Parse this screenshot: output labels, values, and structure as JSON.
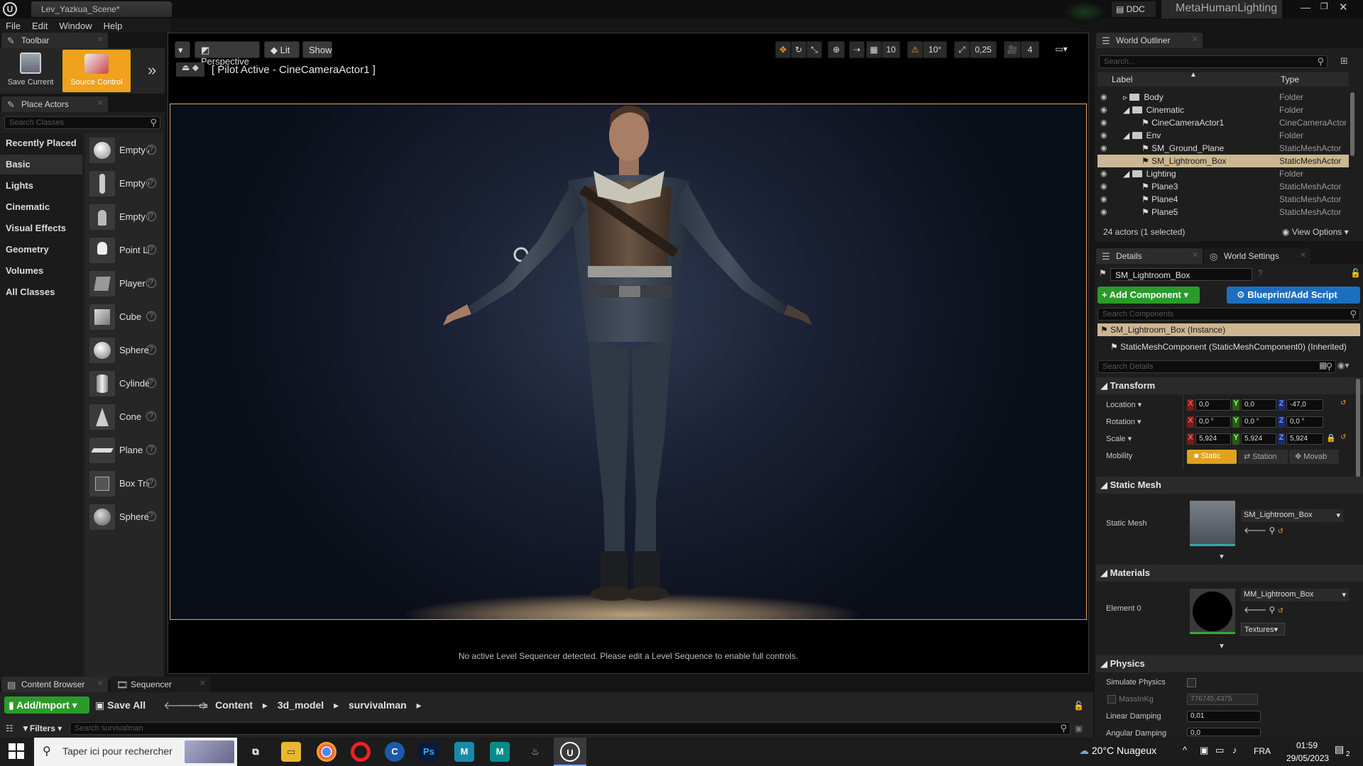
{
  "window": {
    "tab_title": "Lev_Yazkua_Scene*",
    "project_name": "MetaHumanLighting",
    "ddc_label": "DDC"
  },
  "menu": [
    "File",
    "Edit",
    "Window",
    "Help"
  ],
  "toolbar": {
    "tab": "Toolbar",
    "save_current": "Save Current",
    "source_control": "Source Control"
  },
  "place_actors": {
    "tab": "Place Actors",
    "search_placeholder": "Search Classes",
    "categories": [
      "Recently Placed",
      "Basic",
      "Lights",
      "Cinematic",
      "Visual Effects",
      "Geometry",
      "Volumes",
      "All Classes"
    ],
    "selected_category": "Basic",
    "items": [
      "Empty Actor",
      "Empty Character",
      "Empty Pawn",
      "Point Light",
      "Player Start",
      "Cube",
      "Sphere",
      "Cylinder",
      "Cone",
      "Plane",
      "Box Trigger",
      "Sphere Trigger"
    ]
  },
  "viewport": {
    "perspective": "Perspective",
    "lit": "Lit",
    "show": "Show",
    "pilot": "[ Pilot Active - CineCameraActor1 ]",
    "grid_snap": "10",
    "rot_snap": "10°",
    "scale_snap": "0,25",
    "cam_speed": "4",
    "sequencer_msg": "No active Level Sequencer detected. Please edit a Level Sequence to enable full controls."
  },
  "outliner": {
    "tab": "World Outliner",
    "search_placeholder": "Search...",
    "col_label": "Label",
    "col_type": "Type",
    "rows": [
      {
        "label": "Body",
        "type": "Folder",
        "indent": 1,
        "folder": true
      },
      {
        "label": "Cinematic",
        "type": "Folder",
        "indent": 1,
        "folder": true
      },
      {
        "label": "CineCameraActor1",
        "type": "CineCameraActor",
        "indent": 2
      },
      {
        "label": "Env",
        "type": "Folder",
        "indent": 1,
        "folder": true
      },
      {
        "label": "SM_Ground_Plane",
        "type": "StaticMeshActor",
        "indent": 2
      },
      {
        "label": "SM_Lightroom_Box",
        "type": "StaticMeshActor",
        "indent": 2,
        "selected": true
      },
      {
        "label": "Lighting",
        "type": "Folder",
        "indent": 1,
        "folder": true
      },
      {
        "label": "Plane3",
        "type": "StaticMeshActor",
        "indent": 2
      },
      {
        "label": "Plane4",
        "type": "StaticMeshActor",
        "indent": 2
      },
      {
        "label": "Plane5",
        "type": "StaticMeshActor",
        "indent": 2
      }
    ],
    "count": "24 actors (1 selected)",
    "view_options": "View Options"
  },
  "details": {
    "tab": "Details",
    "tab2": "World Settings",
    "name": "SM_Lightroom_Box",
    "add_component": "+ Add Component",
    "blueprint": "Blueprint/Add Script",
    "search_components": "Search Components",
    "instance": "SM_Lightroom_Box (Instance)",
    "component": "StaticMeshComponent (StaticMeshComponent0) (Inherited)",
    "search_details": "Search Details",
    "transform": {
      "title": "Transform",
      "location_label": "Location",
      "rotation_label": "Rotation",
      "scale_label": "Scale",
      "mobility_label": "Mobility",
      "location": [
        "0,0",
        "0,0",
        "-47,0"
      ],
      "rotation": [
        "0,0 °",
        "0,0 °",
        "0,0 °"
      ],
      "scale": [
        "5,924",
        "5,924",
        "5,924"
      ],
      "mobility": [
        "Static",
        "Station",
        "Movab"
      ]
    },
    "static_mesh": {
      "title": "Static Mesh",
      "label": "Static Mesh",
      "value": "SM_Lightroom_Box"
    },
    "materials": {
      "title": "Materials",
      "label": "Element 0",
      "value": "MM_Lightroom_Box",
      "textures": "Textures"
    },
    "physics": {
      "title": "Physics",
      "simulate": "Simulate Physics",
      "mass": "MassInKg",
      "mass_value": "776745,4375",
      "linear": "Linear Damping",
      "linear_value": "0,01",
      "angular": "Angular Damping",
      "angular_value": "0,0"
    }
  },
  "content_browser": {
    "tab": "Content Browser",
    "tab2": "Sequencer",
    "add_import": "Add/Import",
    "save_all": "Save All",
    "path": [
      "Content",
      "3d_model",
      "survivalman"
    ],
    "filters": "Filters",
    "search_placeholder": "Search survivalman"
  },
  "taskbar": {
    "search": "Taper ici pour rechercher",
    "weather": "20°C Nuageux",
    "lang": "FRA",
    "time": "01:59",
    "date": "29/05/2023",
    "notif": "2"
  }
}
